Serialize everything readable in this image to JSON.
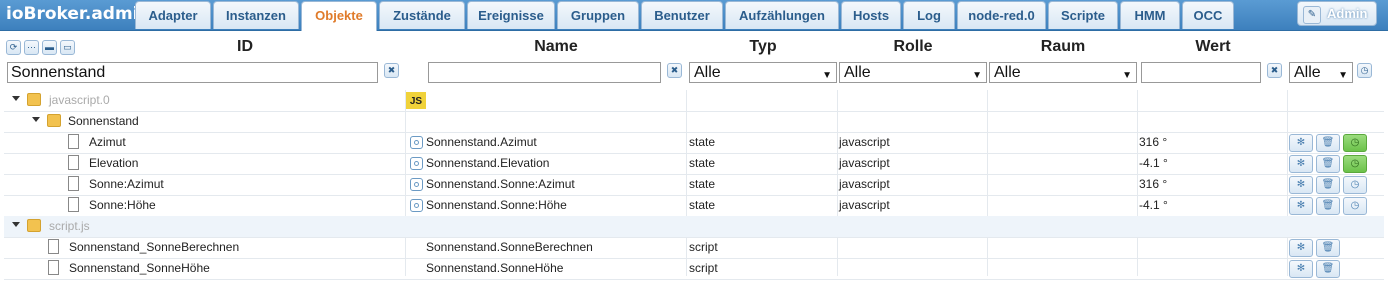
{
  "app": {
    "brand": "ioBroker.admin",
    "user": "Admin"
  },
  "tabs": [
    {
      "label": "Adapter"
    },
    {
      "label": "Instanzen"
    },
    {
      "label": "Objekte"
    },
    {
      "label": "Zustände"
    },
    {
      "label": "Ereignisse"
    },
    {
      "label": "Gruppen"
    },
    {
      "label": "Benutzer"
    },
    {
      "label": "Aufzählungen"
    },
    {
      "label": "Hosts"
    },
    {
      "label": "Log"
    },
    {
      "label": "node-red.0"
    },
    {
      "label": "Scripte"
    },
    {
      "label": "HMM"
    },
    {
      "label": "OCC"
    }
  ],
  "active_tab": "Objekte",
  "columns": {
    "id": "ID",
    "name": "Name",
    "type": "Typ",
    "role": "Rolle",
    "room": "Raum",
    "value": "Wert"
  },
  "filters": {
    "id": "Sonnenstand",
    "name": "",
    "type": "Alle",
    "role": "Alle",
    "room": "Alle",
    "value": "",
    "last": "Alle"
  },
  "rows": [
    {
      "id": "javascript.0",
      "name": "",
      "type": "",
      "role": "",
      "value": ""
    },
    {
      "id": "Sonnenstand",
      "name": "",
      "type": "",
      "role": "",
      "value": ""
    },
    {
      "id": "Azimut",
      "name": "Sonnenstand.Azimut",
      "type": "state",
      "role": "javascript",
      "value": "316 °"
    },
    {
      "id": "Elevation",
      "name": "Sonnenstand.Elevation",
      "type": "state",
      "role": "javascript",
      "value": "-4.1 °"
    },
    {
      "id": "Sonne:Azimut",
      "name": "Sonnenstand.Sonne:Azimut",
      "type": "state",
      "role": "javascript",
      "value": "316 °"
    },
    {
      "id": "Sonne:Höhe",
      "name": "Sonnenstand.Sonne:Höhe",
      "type": "state",
      "role": "javascript",
      "value": "-4.1 °"
    },
    {
      "id": "script.js",
      "name": "",
      "type": "",
      "role": "",
      "value": ""
    },
    {
      "id": "Sonnenstand_SonneBerechnen",
      "name": "Sonnenstand.SonneBerechnen",
      "type": "script",
      "role": "",
      "value": ""
    },
    {
      "id": "Sonnenstand_SonneHöhe",
      "name": "Sonnenstand.SonneHöhe",
      "type": "script",
      "role": "",
      "value": ""
    }
  ],
  "badges": {
    "js": "JS"
  },
  "colors": {
    "topbar": "#3d80bd",
    "active_tab_text": "#e07b2a",
    "js_badge": "#f0d23a",
    "folder": "#f2c24f",
    "green_button": "#6cc24a"
  },
  "icons": [
    "refresh-icon",
    "collapse-icon",
    "folder-icon",
    "open-folder-icon",
    "clear-icon",
    "gear-icon",
    "trash-icon",
    "clock-icon",
    "pencil-icon"
  ]
}
